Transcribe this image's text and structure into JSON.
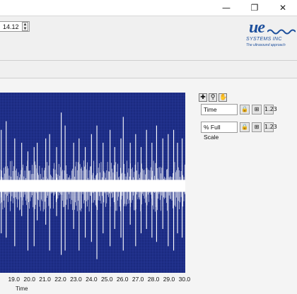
{
  "window": {
    "minimize_glyph": "—",
    "restore_glyph": "❐",
    "close_glyph": "✕"
  },
  "toolbar": {
    "numeric_value": "14.12",
    "spin_up": "▲",
    "spin_down": "▼"
  },
  "logo": {
    "mark": "ue",
    "company": "SYSTEMS INC",
    "tagline": "The ultrasound approach"
  },
  "graph_tools": [
    {
      "name": "crosshair-cursor-icon",
      "glyph": "✚"
    },
    {
      "name": "zoom-icon",
      "glyph": "⚲"
    },
    {
      "name": "pan-hand-icon",
      "glyph": "✋"
    }
  ],
  "scales": [
    {
      "name": "Time",
      "lock": "🔒",
      "autoscale": "⊞",
      "format": "1.23"
    },
    {
      "name": "% Full Scale",
      "lock": "🔒",
      "autoscale": "⊞",
      "format": "1.23"
    }
  ],
  "colors": {
    "plot_background": "#1b2a80",
    "trace": "#ffffff",
    "logo": "#1d4f9c"
  },
  "chart_data": {
    "type": "line",
    "xlabel": "Time",
    "ylabel": "",
    "x_ticks": [
      "19.0",
      "20.0",
      "21.0",
      "22.0",
      "23.0",
      "24.0",
      "25.0",
      "26.0",
      "27.0",
      "28.0",
      "29.0",
      "30.0"
    ],
    "xlim": [
      18.1,
      30.05
    ],
    "grid": true,
    "series": [
      {
        "values_note": "",
        "baseline_band": [
          -0.25,
          0.25
        ],
        "spikes": [
          {
            "t": 18.18,
            "up": 0.65,
            "down": 0.55
          },
          {
            "t": 18.5,
            "up": 0.75,
            "down": 0.6
          },
          {
            "t": 19.05,
            "up": 0.55,
            "down": 0.7
          },
          {
            "t": 19.5,
            "up": 0.5,
            "down": 0.35
          },
          {
            "t": 19.9,
            "up": 0.4,
            "down": 0.75
          },
          {
            "t": 20.3,
            "up": 0.45,
            "down": 0.7
          },
          {
            "t": 20.5,
            "up": 0.5,
            "down": 0.4
          },
          {
            "t": 21.05,
            "up": 0.55,
            "down": 0.45
          },
          {
            "t": 21.3,
            "up": 0.6,
            "down": 0.75
          },
          {
            "t": 21.75,
            "up": 0.45,
            "down": 0.35
          },
          {
            "t": 22.05,
            "up": 0.85,
            "down": 0.8
          },
          {
            "t": 22.3,
            "up": 0.7,
            "down": 0.75
          },
          {
            "t": 22.85,
            "up": 0.5,
            "down": 0.5
          },
          {
            "t": 23.2,
            "up": 0.55,
            "down": 0.75
          },
          {
            "t": 23.6,
            "up": 0.45,
            "down": 0.6
          },
          {
            "t": 24.0,
            "up": 0.6,
            "down": 0.65
          },
          {
            "t": 24.35,
            "up": 0.7,
            "down": 0.85
          },
          {
            "t": 24.75,
            "up": 0.5,
            "down": 0.55
          },
          {
            "t": 25.2,
            "up": 0.65,
            "down": 0.7
          },
          {
            "t": 25.5,
            "up": 0.45,
            "down": 0.5
          },
          {
            "t": 25.9,
            "up": 0.55,
            "down": 0.6
          },
          {
            "t": 26.05,
            "up": 0.8,
            "down": 0.75
          },
          {
            "t": 26.5,
            "up": 0.5,
            "down": 0.45
          },
          {
            "t": 26.85,
            "up": 0.6,
            "down": 0.7
          },
          {
            "t": 27.2,
            "up": 0.45,
            "down": 0.55
          },
          {
            "t": 27.55,
            "up": 0.65,
            "down": 0.5
          },
          {
            "t": 27.9,
            "up": 0.5,
            "down": 0.6
          },
          {
            "t": 28.2,
            "up": 0.7,
            "down": 0.65
          },
          {
            "t": 28.6,
            "up": 0.55,
            "down": 0.5
          },
          {
            "t": 28.95,
            "up": 0.6,
            "down": 0.7
          },
          {
            "t": 29.3,
            "up": 0.65,
            "down": 0.75
          },
          {
            "t": 29.55,
            "up": 0.5,
            "down": 0.55
          },
          {
            "t": 29.85,
            "up": 0.55,
            "down": 0.6
          }
        ]
      }
    ]
  }
}
